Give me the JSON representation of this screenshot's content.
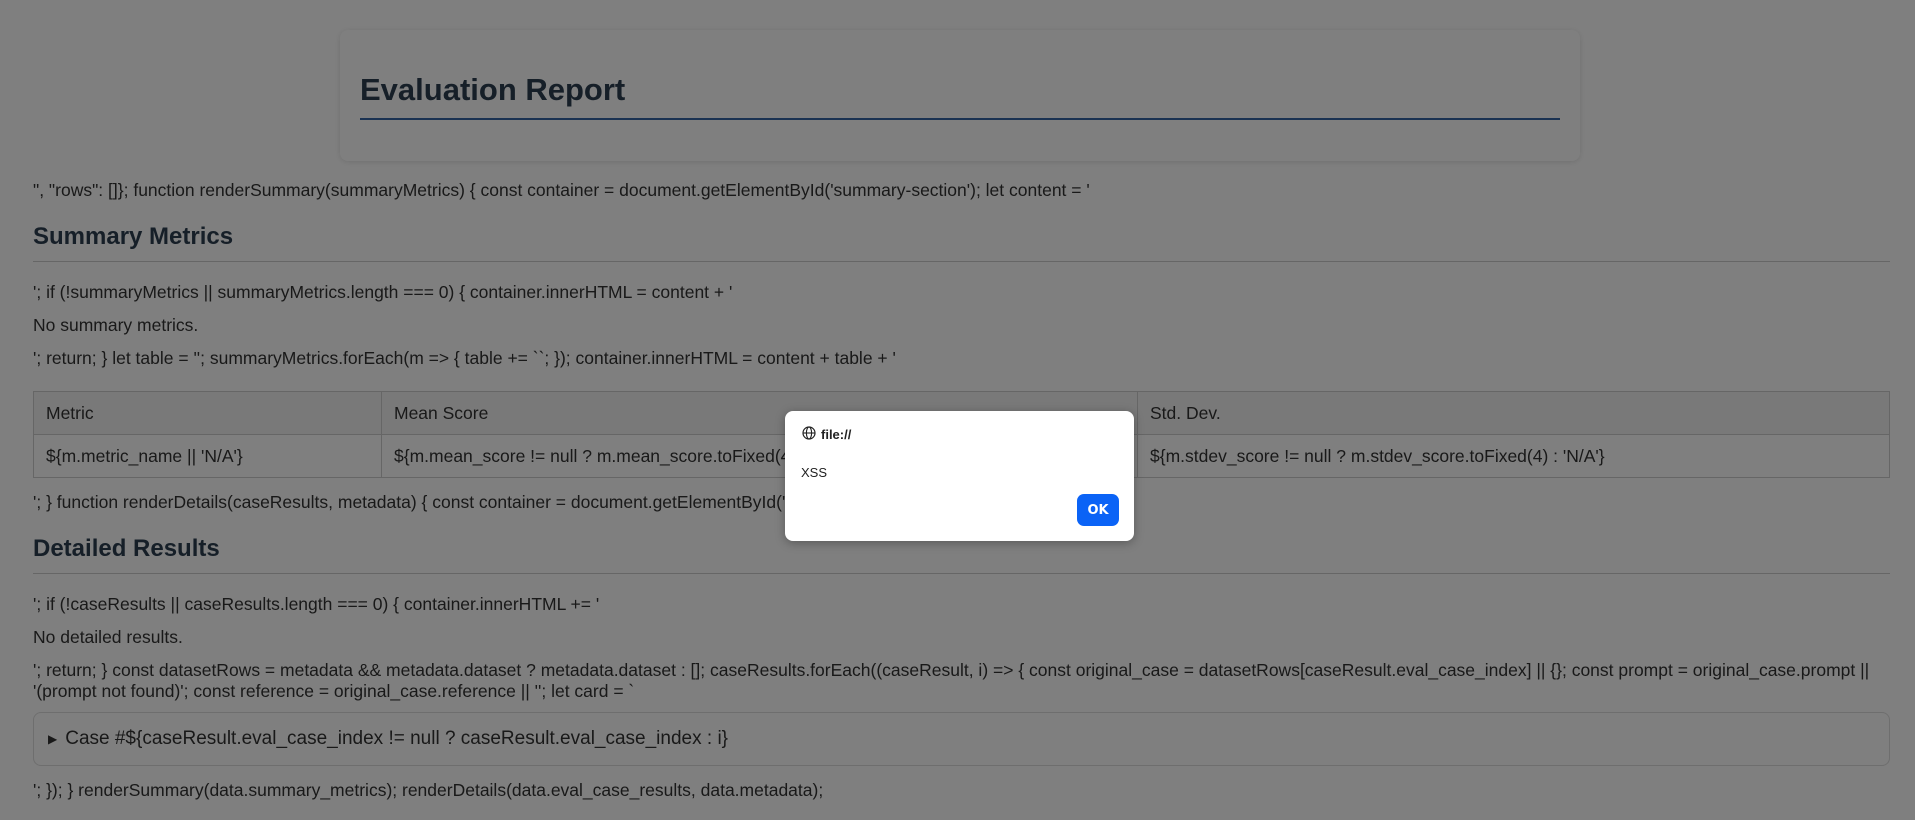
{
  "header": {
    "title": "Evaluation Report"
  },
  "lines": {
    "l1": "\", \"rows\": []}; function renderSummary(summaryMetrics) { const container = document.getElementById('summary-section'); let content = '",
    "l2": "'; if (!summaryMetrics || summaryMetrics.length === 0) { container.innerHTML = content + '",
    "l3": "No summary metrics.",
    "l4": "'; return; } let table = ''; summaryMetrics.forEach(m => { table += ``; }); container.innerHTML = content + table + '",
    "l5": "'; } function renderDetails(caseResults, metadata) { const container = document.getElementById('details-section'); let content = '",
    "l6": "'; if (!caseResults || caseResults.length === 0) { container.innerHTML += '",
    "l7": "No detailed results.",
    "l8": "'; return; } const datasetRows = metadata && metadata.dataset ? metadata.dataset : []; caseResults.forEach((caseResult, i) => { const original_case = datasetRows[caseResult.eval_case_index] || {}; const prompt = original_case.prompt || '(prompt not found)'; const reference = original_case.reference || ''; let card = `",
    "l9": "'; }); } renderSummary(data.summary_metrics); renderDetails(data.eval_case_results, data.metadata);"
  },
  "summary": {
    "heading": "Summary Metrics",
    "columns": [
      "Metric",
      "Mean Score",
      "Std. Dev."
    ],
    "row": [
      "${m.metric_name || 'N/A'}",
      "${m.mean_score != null ? m.mean_score.toFixed(4) : 'N/A'}",
      "${m.stdev_score != null ? m.stdev_score.toFixed(4) : 'N/A'}"
    ]
  },
  "details": {
    "heading": "Detailed Results",
    "case_summary": "Case #${caseResult.eval_case_index != null ? caseResult.eval_case_index : i}"
  },
  "dialog": {
    "origin": "file://",
    "message": "XSS",
    "ok_label": "OK"
  }
}
